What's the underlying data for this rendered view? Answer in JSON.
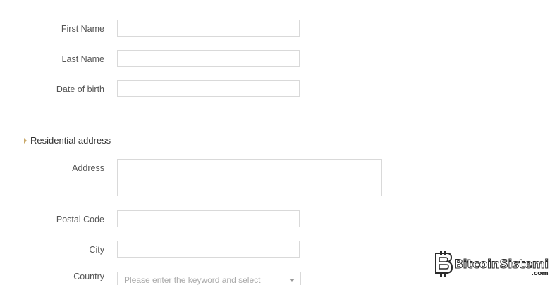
{
  "form": {
    "first_name_label": "First Name",
    "last_name_label": "Last Name",
    "dob_label": "Date of birth",
    "first_name_value": "",
    "last_name_value": "",
    "dob_value": ""
  },
  "residential": {
    "title": "Residential address",
    "address_label": "Address",
    "postal_label": "Postal Code",
    "city_label": "City",
    "country_label": "Country",
    "country_placeholder": "Please enter the keyword and select"
  },
  "watermark": {
    "name": "BitcoinSistemi",
    "suffix": ".com"
  },
  "colors": {
    "field_border": "#d9d9d9",
    "section_marker": "#c9a96a",
    "label_text": "#555555"
  }
}
